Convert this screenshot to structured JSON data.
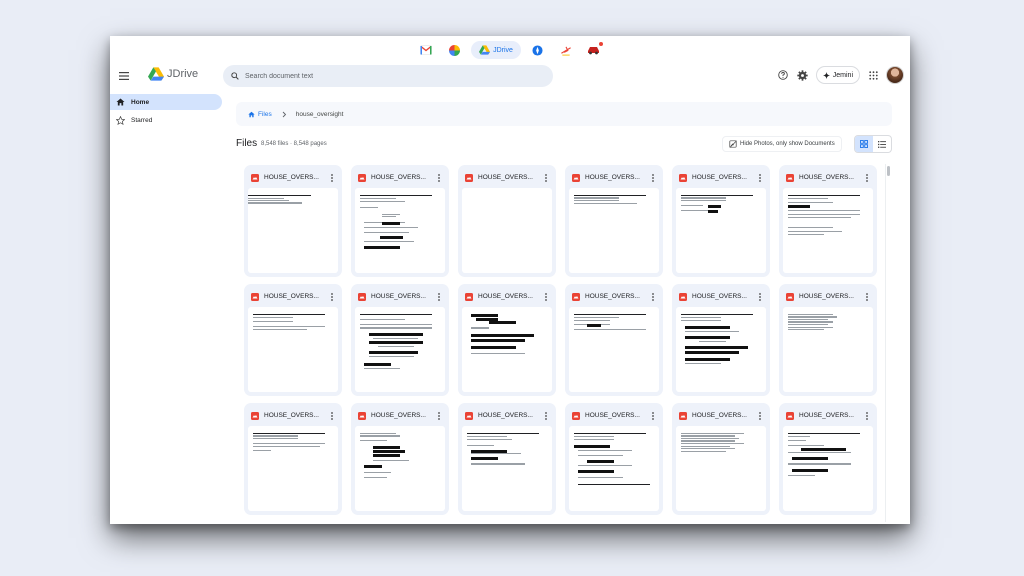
{
  "dock": [
    {
      "name": "gmail",
      "label": "",
      "active": false
    },
    {
      "name": "pinwheel",
      "label": "",
      "active": false
    },
    {
      "name": "jdrive",
      "label": "JDrive",
      "active": true
    },
    {
      "name": "compass",
      "label": "",
      "active": false
    },
    {
      "name": "plane",
      "label": "",
      "active": false
    },
    {
      "name": "car",
      "label": "",
      "active": false
    }
  ],
  "header": {
    "logo_text": "JDrive",
    "search_placeholder": "Search document text",
    "jemini_label": "Jemini"
  },
  "sidebar": {
    "items": [
      {
        "label": "Home",
        "icon": "home-icon",
        "active": true
      },
      {
        "label": "Starred",
        "icon": "star-icon",
        "active": false
      }
    ]
  },
  "breadcrumb": {
    "root": "Files",
    "current": "house_oversight"
  },
  "main": {
    "title": "Files",
    "count": "8,548 files · 8,548 pages",
    "filter_label": "Hide Photos, only show Documents"
  },
  "files": [
    {
      "name": "HOUSE_OVERS..."
    },
    {
      "name": "HOUSE_OVERS..."
    },
    {
      "name": "HOUSE_OVERS..."
    },
    {
      "name": "HOUSE_OVERS..."
    },
    {
      "name": "HOUSE_OVERS..."
    },
    {
      "name": "HOUSE_OVERS..."
    },
    {
      "name": "HOUSE_OVERS..."
    },
    {
      "name": "HOUSE_OVERS..."
    },
    {
      "name": "HOUSE_OVERS..."
    },
    {
      "name": "HOUSE_OVERS..."
    },
    {
      "name": "HOUSE_OVERS..."
    },
    {
      "name": "HOUSE_OVERS..."
    },
    {
      "name": "HOUSE_OVERS..."
    },
    {
      "name": "HOUSE_OVERS..."
    },
    {
      "name": "HOUSE_OVERS..."
    },
    {
      "name": "HOUSE_OVERS..."
    },
    {
      "name": "HOUSE_OVERS..."
    },
    {
      "name": "HOUSE_OVERS..."
    }
  ]
}
